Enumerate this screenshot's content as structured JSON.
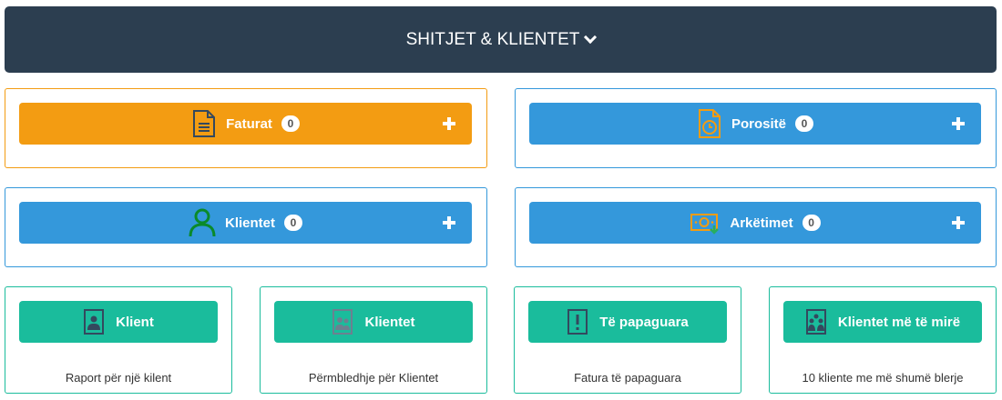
{
  "header": {
    "title": "SHITJET & KLIENTET"
  },
  "cards": [
    {
      "label": "Faturat",
      "count": "0",
      "color": "#f39c12",
      "icon": "document-icon"
    },
    {
      "label": "Porositë",
      "count": "0",
      "color": "#3498db",
      "icon": "clock-document-icon"
    },
    {
      "label": "Klientet",
      "count": "0",
      "color": "#3498db",
      "icon": "user-icon"
    },
    {
      "label": "Arkëtimet",
      "count": "0",
      "color": "#3498db",
      "icon": "money-icon"
    }
  ],
  "reports": [
    {
      "label": "Klient",
      "description": "Raport për një kilent",
      "icon": "contact-icon"
    },
    {
      "label": "Klientet",
      "description": "Përmbledhje për Klientet",
      "icon": "group-contact-icon"
    },
    {
      "label": "Të papaguara",
      "description": "Fatura të papaguara",
      "icon": "exclamation-icon"
    },
    {
      "label": "Klientet më të mirë",
      "description": "10 kliente me më shumë blerje",
      "icon": "group-contact-icon"
    }
  ],
  "colors": {
    "header": "#2c3e50",
    "orange": "#f39c12",
    "blue": "#3498db",
    "teal": "#1abc9c"
  }
}
